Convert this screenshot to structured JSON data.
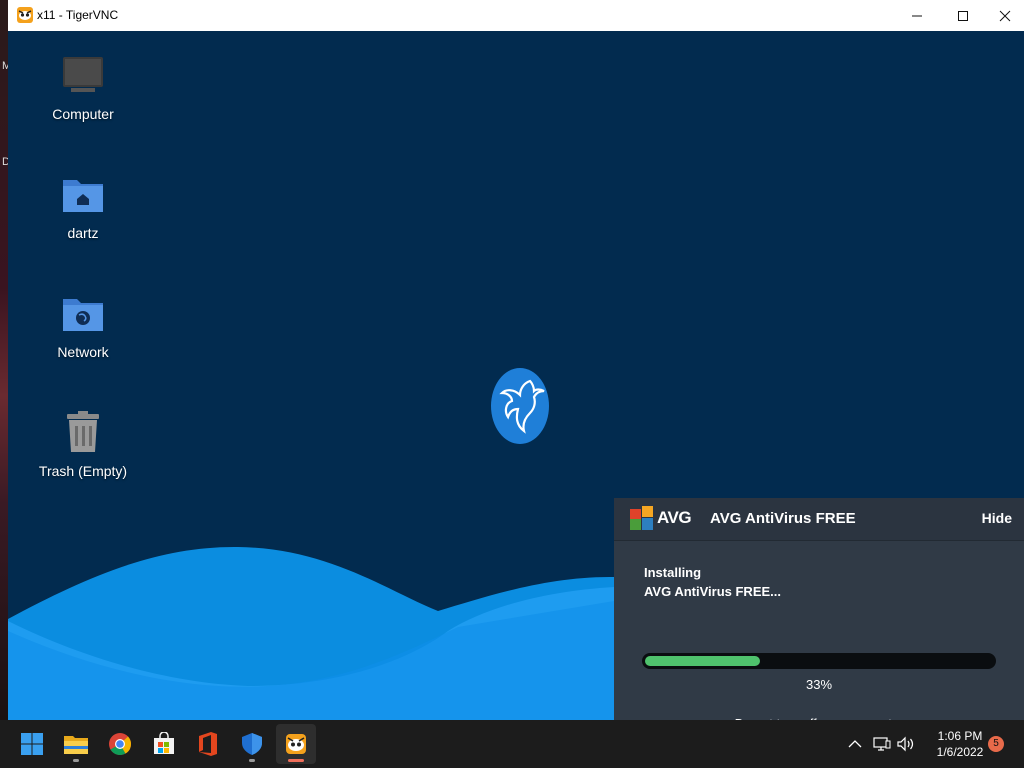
{
  "host": {
    "edge_letters": [
      "M",
      "D"
    ]
  },
  "window": {
    "title": "x11 - TigerVNC",
    "controls": {
      "minimize": "minimize-icon",
      "maximize": "maximize-icon",
      "close": "close-icon"
    }
  },
  "desktop": {
    "background_color": "#022b4f",
    "icons": [
      {
        "label": "Computer",
        "icon": "computer-icon"
      },
      {
        "label": "dartz",
        "icon": "home-folder-icon"
      },
      {
        "label": "Network",
        "icon": "network-folder-icon"
      },
      {
        "label": "Trash (Empty)",
        "icon": "trash-icon"
      }
    ]
  },
  "avg": {
    "logo_text": "AVG",
    "title": "AVG AntiVirus FREE",
    "hide_label": "Hide",
    "status_line1": "Installing",
    "status_line2": "AVG AntiVirus FREE...",
    "progress": 0.33,
    "progress_label": "33%",
    "note": "Do not turn off your computer",
    "accent": "#4fc26d"
  },
  "taskbar": {
    "apps": [
      {
        "name": "start-button",
        "icon": "windows-start-icon"
      },
      {
        "name": "file-explorer",
        "icon": "folder-icon"
      },
      {
        "name": "chrome",
        "icon": "chrome-icon"
      },
      {
        "name": "microsoft-store",
        "icon": "store-icon"
      },
      {
        "name": "office",
        "icon": "office-icon"
      },
      {
        "name": "windows-security",
        "icon": "shield-icon"
      },
      {
        "name": "tigervnc",
        "icon": "tigervnc-icon"
      }
    ],
    "tray": {
      "chevron": "chevron-up-icon",
      "network": "network-icon",
      "volume": "volume-icon"
    },
    "clock": {
      "time": "1:06 PM",
      "date": "1/6/2022"
    },
    "notification_count": "5"
  }
}
